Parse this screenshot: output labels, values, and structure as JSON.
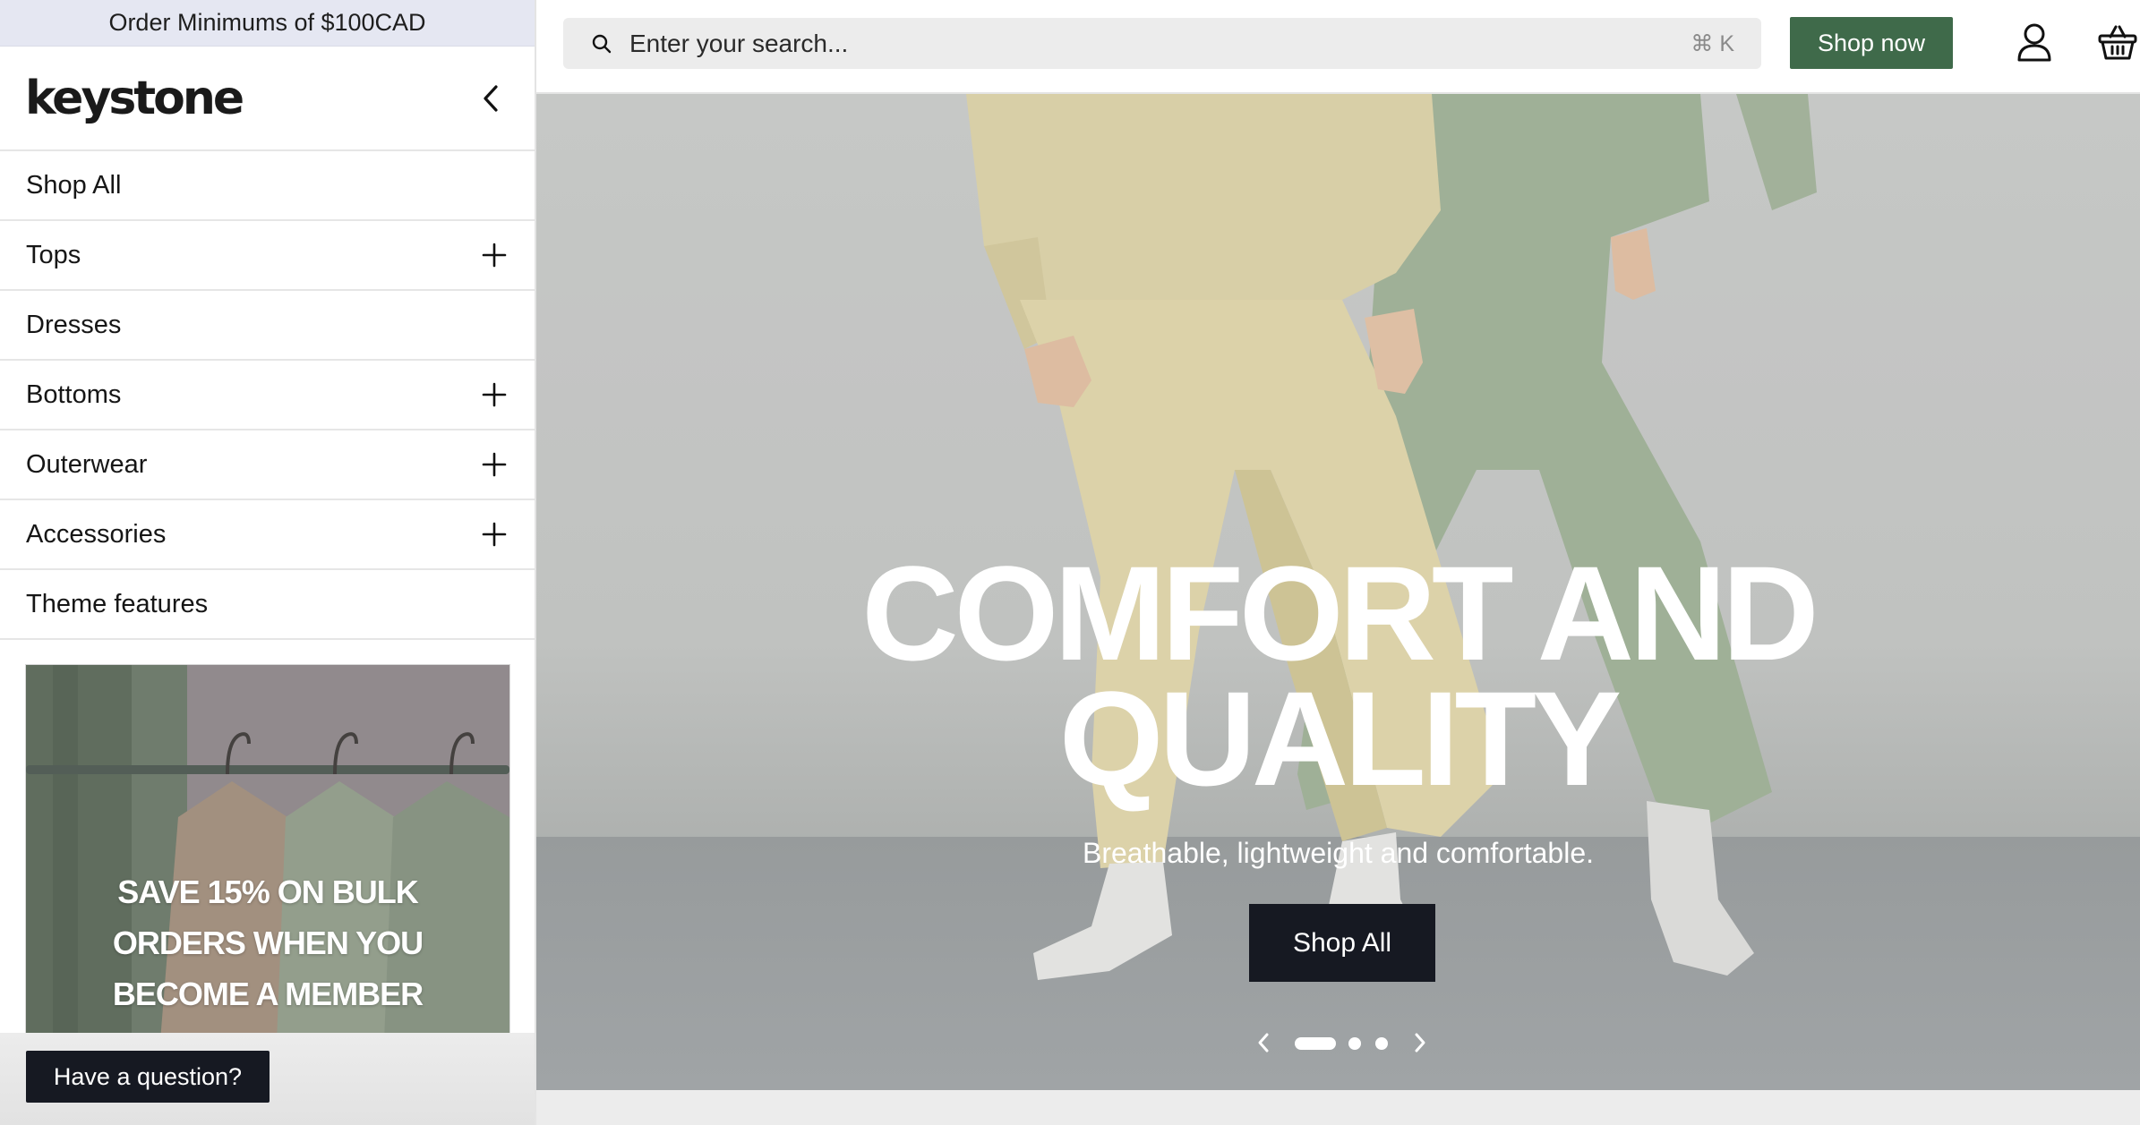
{
  "announcement": "Order Minimums of $100CAD",
  "brand": {
    "logo_text": "keystone"
  },
  "sidebar": {
    "items": [
      {
        "label": "Shop All",
        "expandable": false
      },
      {
        "label": "Tops",
        "expandable": true
      },
      {
        "label": "Dresses",
        "expandable": false
      },
      {
        "label": "Bottoms",
        "expandable": true
      },
      {
        "label": "Outerwear",
        "expandable": true
      },
      {
        "label": "Accessories",
        "expandable": true
      },
      {
        "label": "Theme features",
        "expandable": false
      }
    ],
    "promo": {
      "line1": "SAVE 15% ON BULK",
      "line2": "ORDERS WHEN YOU",
      "line3": "BECOME A MEMBER"
    },
    "chat_label": "Have a question?"
  },
  "header": {
    "search_placeholder": "Enter your search...",
    "search_shortcut": "⌘ K",
    "shop_now_label": "Shop now",
    "icons": [
      "account-icon",
      "basket-icon"
    ],
    "accent_color": "#3f6a4a"
  },
  "hero": {
    "title_line1": "COMFORT AND",
    "title_line2": "QUALITY",
    "subtitle": "Breathable, lightweight and comfortable.",
    "cta_label": "Shop All",
    "slides_total": 3,
    "active_slide": 1
  }
}
